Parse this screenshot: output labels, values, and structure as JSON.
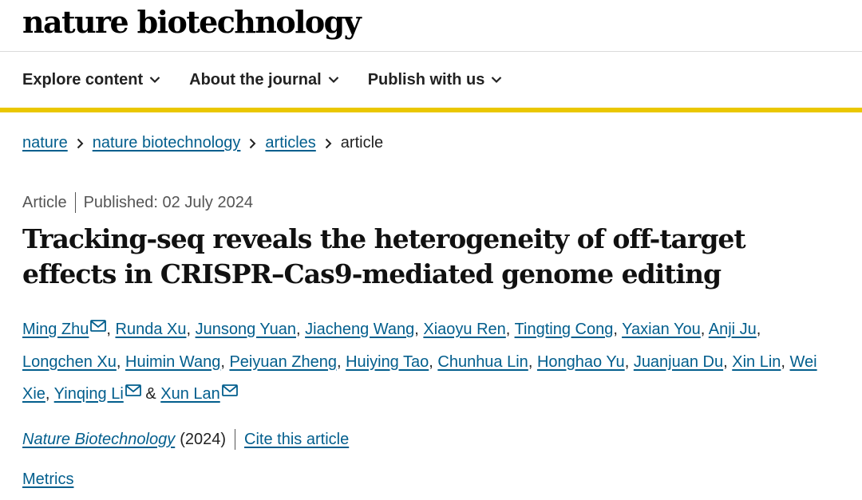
{
  "header": {
    "logo": "nature biotechnology"
  },
  "nav": {
    "items": [
      {
        "label": "Explore content",
        "icon": "chevron-down-icon"
      },
      {
        "label": "About the journal",
        "icon": "chevron-down-icon"
      },
      {
        "label": "Publish with us",
        "icon": "chevron-down-icon"
      }
    ]
  },
  "breadcrumb": {
    "items": [
      "nature",
      "nature biotechnology",
      "articles"
    ],
    "current": "article"
  },
  "article": {
    "type": "Article",
    "published": "Published: 02 July 2024",
    "title": "Tracking-seq reveals the heterogeneity of off-target effects in CRISPR–Cas9-mediated genome editing",
    "authors": [
      {
        "name": "Ming Zhu",
        "email_icon": true
      },
      {
        "name": "Runda Xu"
      },
      {
        "name": "Junsong Yuan"
      },
      {
        "name": "Jiacheng Wang"
      },
      {
        "name": "Xiaoyu Ren"
      },
      {
        "name": "Tingting Cong"
      },
      {
        "name": "Yaxian You"
      },
      {
        "name": "Anji Ju"
      },
      {
        "name": "Longchen Xu"
      },
      {
        "name": "Huimin Wang"
      },
      {
        "name": "Peiyuan Zheng"
      },
      {
        "name": "Huiying Tao"
      },
      {
        "name": "Chunhua Lin"
      },
      {
        "name": "Honghao Yu"
      },
      {
        "name": "Juanjuan Du"
      },
      {
        "name": "Xin Lin"
      },
      {
        "name": "Wei Xie"
      },
      {
        "name": "Yinqing Li",
        "email_icon": true
      },
      {
        "name": "Xun Lan",
        "email_icon": true
      }
    ],
    "journal": "Nature Biotechnology",
    "year": "(2024)",
    "cite": "Cite this article",
    "metrics": "Metrics"
  },
  "colors": {
    "link": "#025e8d",
    "accent_bar": "#eac700",
    "text": "#222222",
    "muted": "#555555"
  }
}
